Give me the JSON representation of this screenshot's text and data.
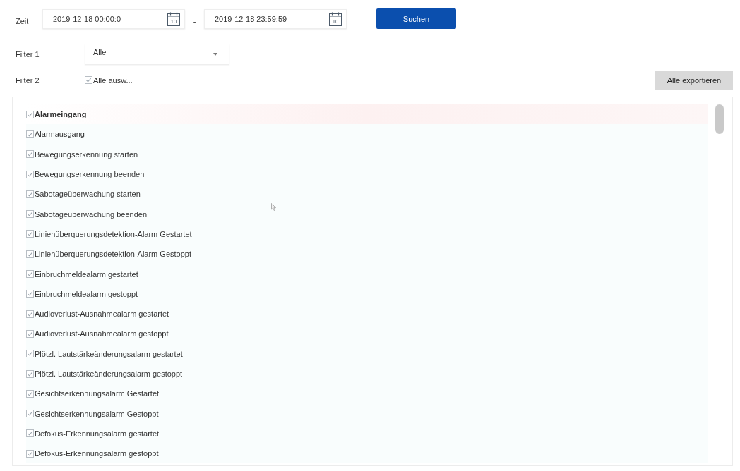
{
  "time": {
    "label": "Zeit",
    "from": {
      "value": "2019-12-18 00:00:0",
      "calendar_day": "10"
    },
    "separator": "-",
    "to": {
      "value": "2019-12-18 23:59:59",
      "calendar_day": "10"
    },
    "search_button": "Suchen"
  },
  "filter1": {
    "label": "Filter 1",
    "value": "Alle"
  },
  "filter2": {
    "label": "Filter 2",
    "select_all": {
      "label": "Alle ausw...",
      "checked": true
    }
  },
  "export_button": "Alle exportieren",
  "events": [
    {
      "label": "Alarmeingang",
      "checked": true,
      "selected": true
    },
    {
      "label": "Alarmausgang",
      "checked": true,
      "selected": false
    },
    {
      "label": "Bewegungserkennung starten",
      "checked": true,
      "selected": false
    },
    {
      "label": "Bewegungserkennung beenden",
      "checked": true,
      "selected": false
    },
    {
      "label": "Sabotageüberwachung starten",
      "checked": true,
      "selected": false
    },
    {
      "label": "Sabotageüberwachung beenden",
      "checked": true,
      "selected": false
    },
    {
      "label": "Linienüberquerungsdetektion-Alarm Gestartet",
      "checked": true,
      "selected": false
    },
    {
      "label": "Linienüberquerungsdetektion-Alarm Gestoppt",
      "checked": true,
      "selected": false
    },
    {
      "label": "Einbruchmeldealarm gestartet",
      "checked": true,
      "selected": false
    },
    {
      "label": "Einbruchmeldealarm gestoppt",
      "checked": true,
      "selected": false
    },
    {
      "label": "Audioverlust-Ausnahmealarm gestartet",
      "checked": true,
      "selected": false
    },
    {
      "label": "Audioverlust-Ausnahmealarm gestoppt",
      "checked": true,
      "selected": false
    },
    {
      "label": "Plötzl. Lautstärkeänderungsalarm gestartet",
      "checked": true,
      "selected": false
    },
    {
      "label": "Plötzl. Lautstärkeänderungsalarm gestoppt",
      "checked": true,
      "selected": false
    },
    {
      "label": "Gesichtserkennungsalarm Gestartet",
      "checked": true,
      "selected": false
    },
    {
      "label": "Gesichtserkennungsalarm Gestoppt",
      "checked": true,
      "selected": false
    },
    {
      "label": "Defokus-Erkennungsalarm gestartet",
      "checked": true,
      "selected": false
    },
    {
      "label": "Defokus-Erkennungsalarm gestoppt",
      "checked": true,
      "selected": false
    }
  ]
}
